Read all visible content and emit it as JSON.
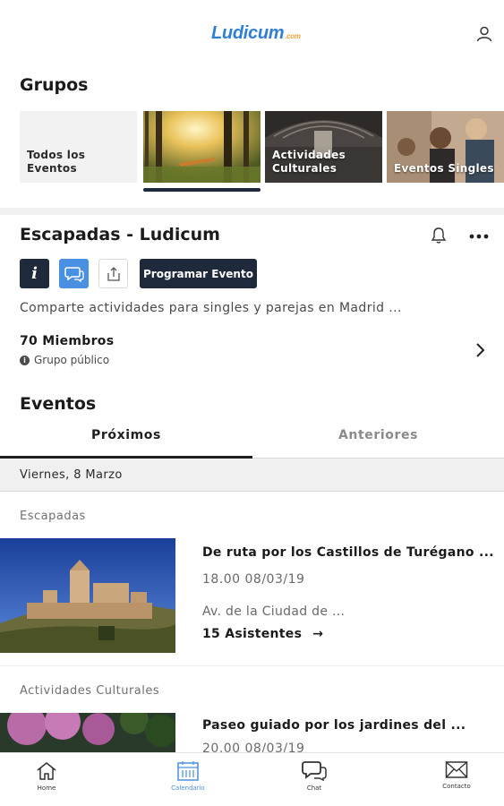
{
  "header": {
    "logo_text": "Ludicum",
    "logo_suffix": ".com",
    "icons": {
      "user": "user-icon"
    }
  },
  "groups": {
    "title": "Grupos",
    "items": [
      {
        "label": "Todos los Eventos"
      },
      {
        "label": ""
      },
      {
        "label": "Actividades Culturales"
      },
      {
        "label": "Eventos Singles"
      }
    ]
  },
  "group_detail": {
    "name": "Escapadas - Ludicum",
    "program_button": "Programar Evento",
    "info_glyph": "i",
    "description": "Comparte actividades para singles y parejas en Madrid ...",
    "members": "70 Miembros",
    "visibility": "Grupo público",
    "icons": {
      "bell": "bell-icon",
      "more": "more-icon",
      "chat": "chat-icon",
      "share": "share-icon",
      "chevron": "chevron-right-icon"
    },
    "colors": {
      "dark": "#1e2a3c",
      "accent": "#4a90e2"
    }
  },
  "events": {
    "title": "Eventos",
    "tabs": [
      {
        "label": "Próximos"
      },
      {
        "label": "Anteriores"
      }
    ],
    "date_header": "Viernes, 8 Marzo",
    "items": [
      {
        "category": "Escapadas",
        "title": "De ruta por los Castillos de Turégano ...",
        "time": "18.00  08/03/19",
        "place": "Av. de la Ciudad de ...",
        "attendees": "15 Asistentes",
        "arrow": "→"
      },
      {
        "category": "Actividades Culturales",
        "title": "Paseo guiado por los jardines del ...",
        "time": "20.00  08/03/19"
      }
    ]
  },
  "bottom_nav": [
    {
      "label": "Home",
      "icon": "home-icon"
    },
    {
      "label": "Calendario",
      "icon": "calendar-icon",
      "active": true
    },
    {
      "label": "Chat",
      "icon": "chat-icon"
    },
    {
      "label": "Contacto",
      "icon": "mail-icon"
    }
  ]
}
